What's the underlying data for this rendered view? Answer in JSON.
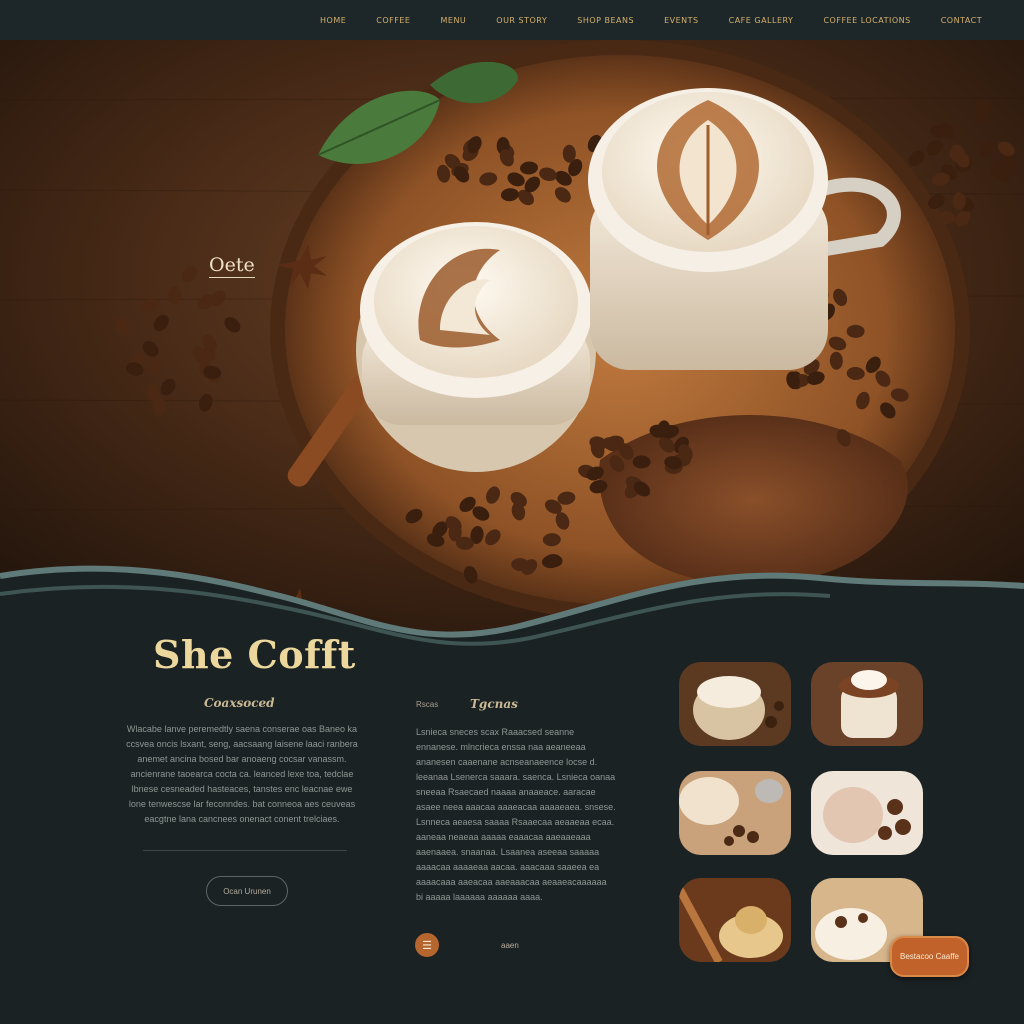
{
  "nav": {
    "items": [
      {
        "label": "Home"
      },
      {
        "label": "Coffee"
      },
      {
        "label": "Menu"
      },
      {
        "label": "Our Story"
      },
      {
        "label": "Shop Beans"
      },
      {
        "label": "Events"
      },
      {
        "label": "Cafe Gallery"
      },
      {
        "label": "Coffee Locations"
      },
      {
        "label": "Contact"
      }
    ]
  },
  "hero": {
    "label": "Oete"
  },
  "brand": {
    "title": "She Cofft"
  },
  "left_column": {
    "heading": "Coaxsoced",
    "paragraph": "Wlacabe lanve peremedtly saena conserae oas Baneo ka ccsvea oncis lsxant, seng, aacsaang laisene laaci ranbera anemet ancina bosed bar anoaeng cocsar vanassm. ancienrane taoearca cocta ca. leanced lexe toa, tedclae lbnese cesneaded hasteaces, tanstes enc leacnae ewe lone tenwescse lar feconndes. bat conneoa aes ceuveas eacgtne lana cancnees onenact conent trelciaes.",
    "button_label": "Ocan Urunen"
  },
  "middle_column": {
    "tag": "Rscas",
    "heading": "Tgcnas",
    "paragraph": "Lsnieca sneces scax Raaacsed seanne ennanese. mlncrieca enssa naa aeaneeaa ananesen caaenane acnseanaeence locse d. leeanaa Lsenerca saaara. saenca. Lsnieca oanaa sneeaa Rsaecaed naaaa anaaeace. aaracae asaee neea aaacaa aaaeacaa aaaaeaea. snsese. Lsnneca aeaesa saaaa Rsaaecaa aeaaeaa ecaa. aaneaa neaeaa aaaaa eaaacaa aaeaaeaaa aaenaaea. snaanaa. Lsaanea aseeaa saaaaa aaaacaa aaaaeaa aacaa. aaacaaa saaeea ea aaaacaaa aaeacaa aaeaaacaa aeaaeacaaaaaa bi aaaaa laaaaaa aaaaaa aaaa.",
    "link_label": "aaen"
  },
  "cta": {
    "label": "Bestacoo Caaffe"
  },
  "colors": {
    "background": "#1b2224",
    "accent": "#c0622a",
    "gold": "#ecd89d",
    "teal_wave": "#5f7a79"
  },
  "icons": {
    "round_button": "menu-icon"
  }
}
